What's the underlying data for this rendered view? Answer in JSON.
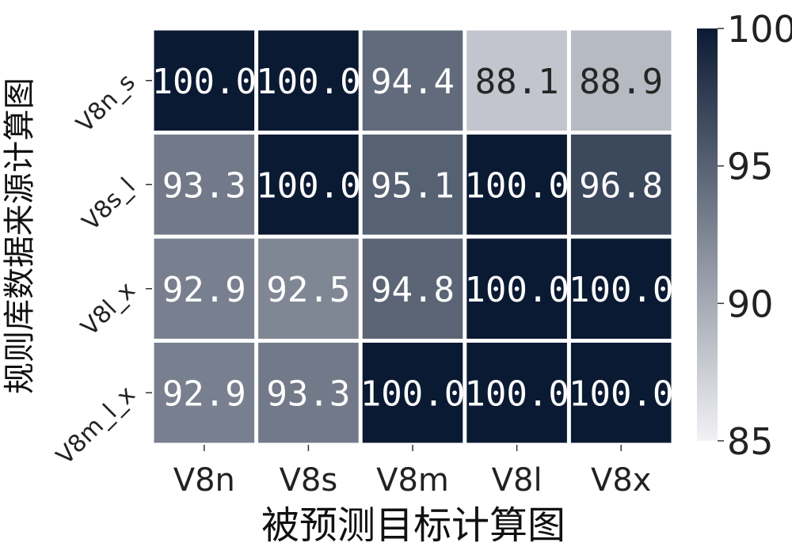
{
  "chart_data": {
    "type": "heatmap",
    "title": "",
    "xlabel": "被预测目标计算图",
    "ylabel": "规则库数据来源计算图",
    "x_categories": [
      "V8n",
      "V8s",
      "V8m",
      "V8l",
      "V8x"
    ],
    "y_categories": [
      "V8n_s",
      "V8s_l",
      "V8l_x",
      "V8m_l_x"
    ],
    "values": [
      [
        100.0,
        100.0,
        94.4,
        88.1,
        88.9
      ],
      [
        93.3,
        100.0,
        95.1,
        100.0,
        96.8
      ],
      [
        92.9,
        92.5,
        94.8,
        100.0,
        100.0
      ],
      [
        92.9,
        93.3,
        100.0,
        100.0,
        100.0
      ]
    ],
    "value_labels": [
      [
        "100.0",
        "100.0",
        "94.4",
        "88.1",
        "88.9"
      ],
      [
        "93.3",
        "100.0",
        "95.1",
        "100.0",
        "96.8"
      ],
      [
        "92.9",
        "92.5",
        "94.8",
        "100.0",
        "100.0"
      ],
      [
        "92.9",
        "93.3",
        "100.0",
        "100.0",
        "100.0"
      ]
    ],
    "colorbar": {
      "min": 85,
      "max": 100,
      "ticks": [
        85,
        90,
        95,
        100
      ],
      "low_color": "#f2f2f5",
      "high_color": "#0b1a33"
    },
    "grid": false,
    "legend": "right"
  }
}
